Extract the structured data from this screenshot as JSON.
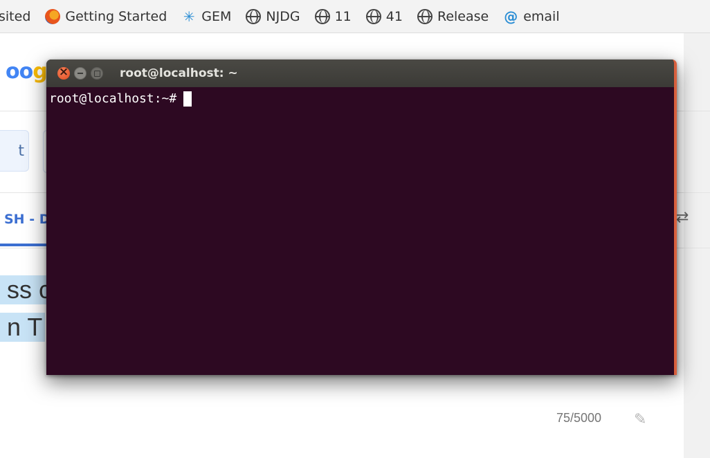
{
  "bookmarks": [
    {
      "label": "sited",
      "icon": "none"
    },
    {
      "label": "Getting Started",
      "icon": "firefox-icon"
    },
    {
      "label": "GEM",
      "icon": "gem-icon"
    },
    {
      "label": "NJDG",
      "icon": "globe-icon"
    },
    {
      "label": "11",
      "icon": "globe-icon"
    },
    {
      "label": "41",
      "icon": "globe-icon"
    },
    {
      "label": "Release",
      "icon": "globe-icon"
    },
    {
      "label": "email",
      "icon": "at-icon"
    }
  ],
  "background_page": {
    "logo_fragment": {
      "a": "oo",
      "b": "g"
    },
    "button_fragment": "t",
    "tab_fragment": "SH - D",
    "text_line1": "ss c",
    "text_line2": "n T",
    "char_counter": "75/5000",
    "swap_icon": "⇄",
    "pencil_icon": "✎"
  },
  "terminal": {
    "title": "root@localhost: ~",
    "prompt": "root@localhost:~#",
    "colors": {
      "background": "#2d0922",
      "titlebar": "#3e3d39",
      "close_button": "#e14b1e"
    }
  }
}
